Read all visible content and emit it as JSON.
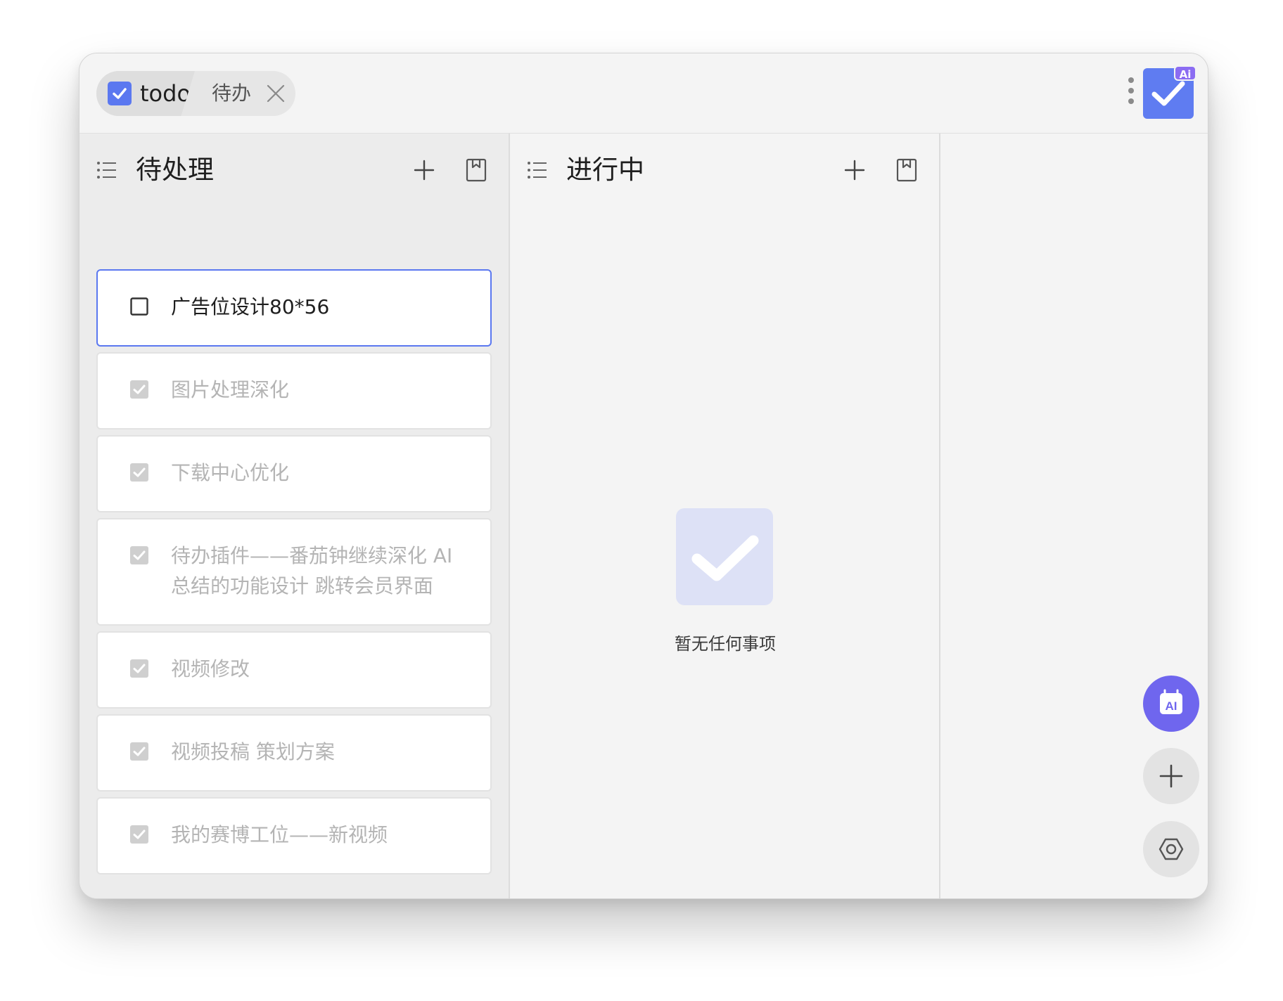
{
  "tabs": {
    "active_label": "todo",
    "second_label": "待办"
  },
  "app": {
    "ai_badge": "Ai",
    "accent_color": "#5b78f0"
  },
  "columns": [
    {
      "title": "待处理",
      "cards": [
        {
          "text": "广告位设计80*56",
          "checked": false
        },
        {
          "text": "图片处理深化",
          "checked": true
        },
        {
          "text": "下载中心优化",
          "checked": true
        },
        {
          "text": "待办插件——番茄钟继续深化   AI总结的功能设计   跳转会员界面",
          "checked": true
        },
        {
          "text": "视频修改",
          "checked": true
        },
        {
          "text": "视频投稿 策划方案",
          "checked": true
        },
        {
          "text": "我的赛博工位——新视频",
          "checked": true
        }
      ]
    },
    {
      "title": "进行中",
      "empty_text": "暂无任何事项"
    }
  ],
  "fab": {
    "ai_label": "AI"
  },
  "icons": [
    "checkbox-icon",
    "close-icon",
    "more-icon",
    "list-icon",
    "plus-icon",
    "bookmark-icon",
    "ai-calendar-icon",
    "settings-icon"
  ]
}
